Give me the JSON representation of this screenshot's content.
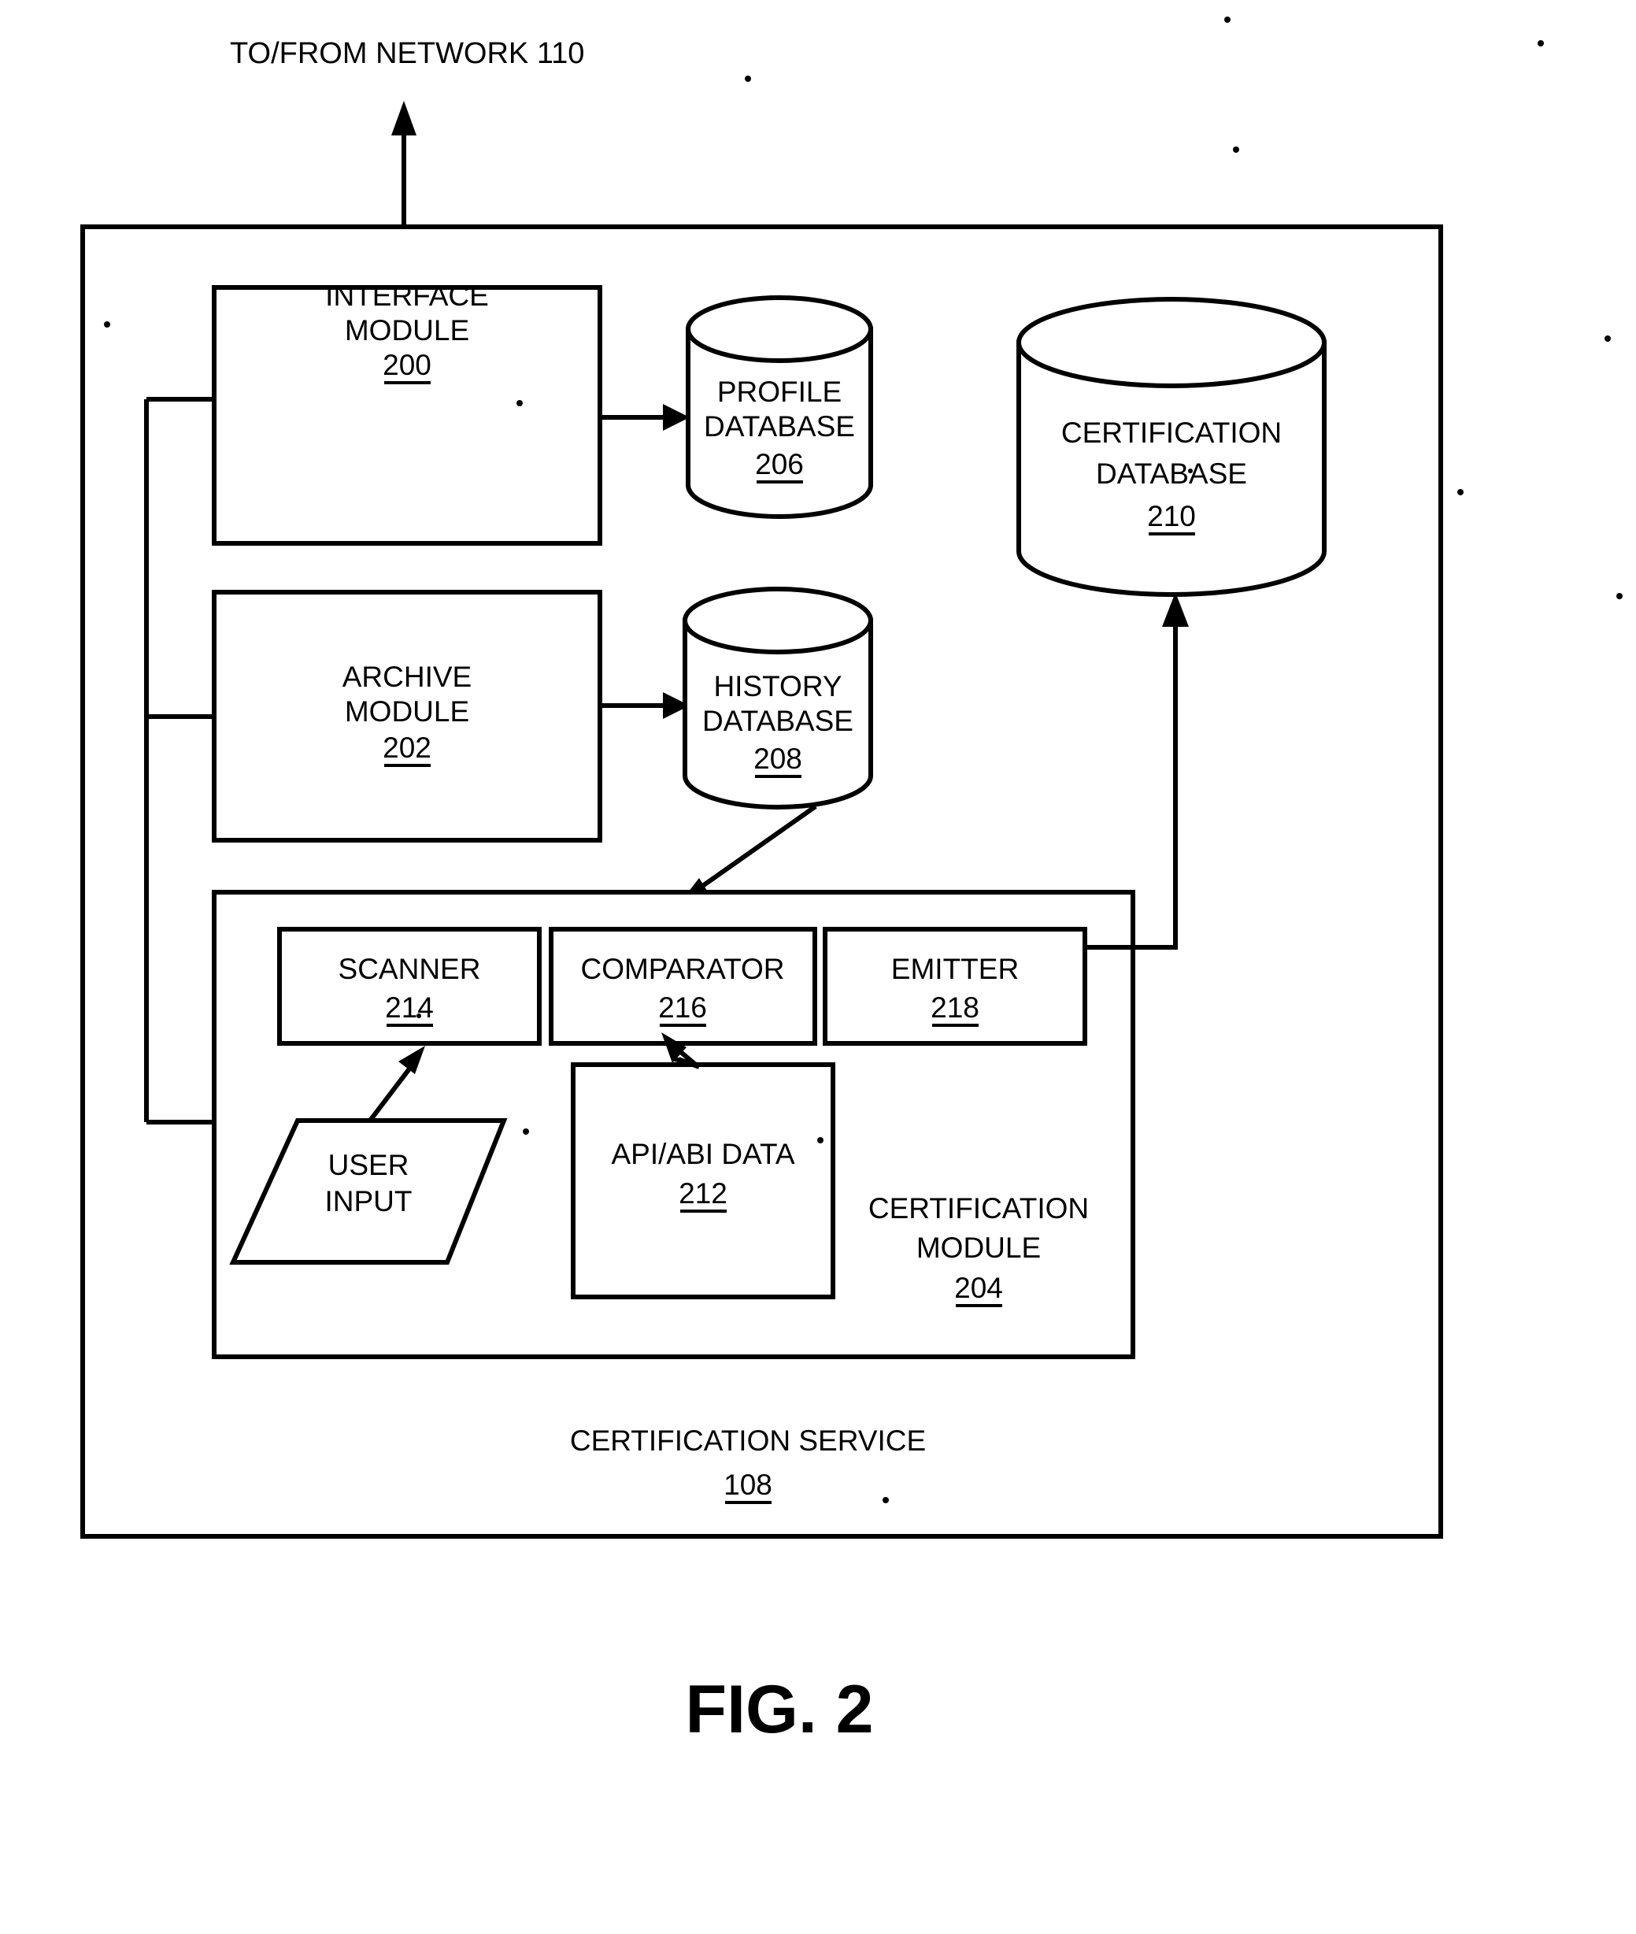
{
  "figure": {
    "caption": "FIG. 2",
    "network_label": "TO/FROM NETWORK 110"
  },
  "outer_container": {
    "title": "CERTIFICATION SERVICE",
    "ref": "108"
  },
  "blocks": {
    "interface_module": {
      "line1": "INTERFACE",
      "line2": "MODULE",
      "ref": "200"
    },
    "archive_module": {
      "line1": "ARCHIVE",
      "line2": "MODULE",
      "ref": "202"
    },
    "certification_module": {
      "line1": "CERTIFICATION",
      "line2": "MODULE",
      "ref": "204"
    },
    "api_abi_data": {
      "line1": "API/ABI DATA",
      "ref": "212"
    },
    "scanner": {
      "line1": "SCANNER",
      "ref": "214"
    },
    "comparator": {
      "line1": "COMPARATOR",
      "ref": "216"
    },
    "emitter": {
      "line1": "EMITTER",
      "ref": "218"
    },
    "user_input": {
      "line1": "USER",
      "line2": "INPUT"
    }
  },
  "databases": {
    "profile_database": {
      "line1": "PROFILE",
      "line2": "DATABASE",
      "ref": "206"
    },
    "history_database": {
      "line1": "HISTORY",
      "line2": "DATABASE",
      "ref": "208"
    },
    "certification_database": {
      "line1": "CERTIFICATION",
      "line2": "DATABASE",
      "ref": "210"
    }
  },
  "colors": {
    "ink": "#000000",
    "paper": "#ffffff"
  }
}
